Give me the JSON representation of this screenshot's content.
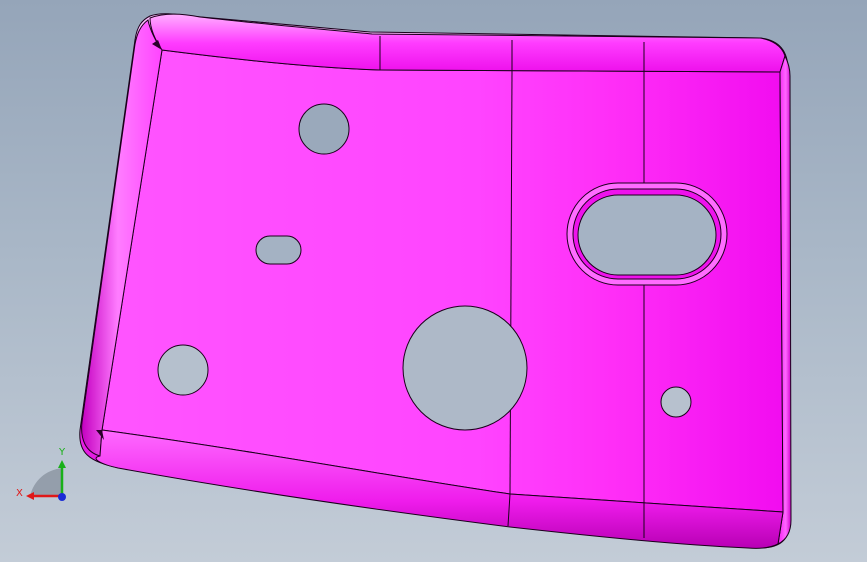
{
  "viewport": {
    "background_top": "#95a5b9",
    "background_bottom": "#c3ccd7"
  },
  "part": {
    "face_color": "#ff4dff",
    "edge_color": "#1a001a",
    "hole_color": "#9aa9bb",
    "hole_count": 6,
    "slot_count": 2
  },
  "triad": {
    "x_label": "X",
    "y_label": "Y",
    "x_color": "#e01818",
    "y_color": "#19b019",
    "z_color": "#1a2bd6"
  }
}
